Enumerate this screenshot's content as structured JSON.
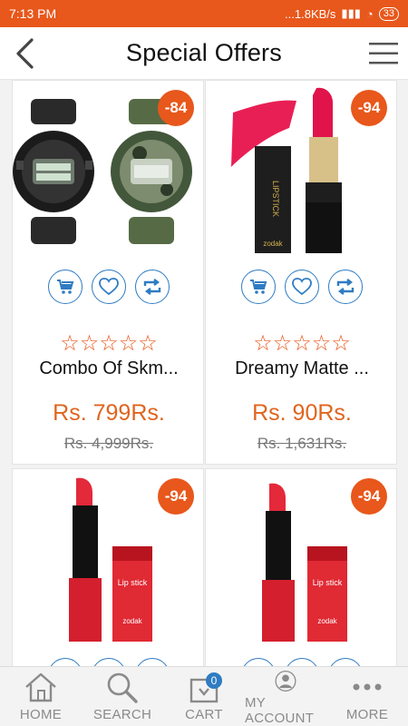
{
  "statusbar": {
    "time": "7:13 PM",
    "net_speed": "...1.8KB/s",
    "battery": "33"
  },
  "header": {
    "title": "Special Offers"
  },
  "products": [
    {
      "name": "Combo Of Skm...",
      "price": "Rs. 799Rs.",
      "mrp": "Rs. 4,999Rs.",
      "discount": "-84",
      "stars": "☆☆☆☆☆",
      "image": "sport-watches-combo"
    },
    {
      "name": "Dreamy Matte ...",
      "price": "Rs. 90Rs.",
      "mrp": "Rs. 1,631Rs.",
      "discount": "-94",
      "stars": "☆☆☆☆☆",
      "image": "zodak-dreamy-matte-lipstick"
    },
    {
      "name": "",
      "price": "",
      "mrp": "",
      "discount": "-94",
      "stars": "",
      "image": "zodak-red-lipstick"
    },
    {
      "name": "",
      "price": "",
      "mrp": "",
      "discount": "-94",
      "stars": "",
      "image": "zodak-red-lipstick"
    }
  ],
  "nav": {
    "home": "HOME",
    "search": "SEARCH",
    "cart": "CART",
    "cart_count": "0",
    "account": "MY ACCOUNT",
    "more": "MORE"
  },
  "colors": {
    "accent": "#e8571b",
    "action_blue": "#2f7cc2",
    "price": "#e0641e"
  }
}
